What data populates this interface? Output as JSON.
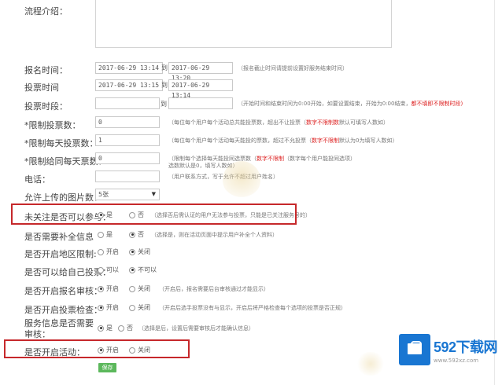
{
  "form": {
    "intro_label": "流程介绍：",
    "signup_time": {
      "label": "报名时间：",
      "start": "2017-06-29 13:14",
      "sep": "到",
      "end": "2017-06-29 13:20",
      "hint": "（报名截止时间请提前设置好服务结束时间）"
    },
    "vote_time": {
      "label": "投票时间",
      "start": "2017-06-29 13:15",
      "sep": "到",
      "end": "2017-06-29 13:14"
    },
    "vote_period": {
      "label": "投票时段：",
      "sep": "到",
      "hint_a": "（开始时间和结束时间为0:00开始，如要设置结束，开始为0:00结束，",
      "hint_red": "都不填即不限制时段)"
    },
    "limit_total": {
      "label": "*限制投票数：",
      "value": "0",
      "hint_a": "（每位每个用户每个活动总共能投票数，超出不让投票（",
      "hint_red": "数字不限制数",
      "hint_b": "默认可填写人数如）"
    },
    "limit_daily": {
      "label": "*限制每天投票数：",
      "value": "1",
      "hint_a": "（每位每个用户每个活动每天能投的票数，超过不允投票（",
      "hint_red": "数字不限制",
      "hint_b": "默认为0为填写人数如）"
    },
    "limit_same": {
      "label": "*限制给同每天票数：",
      "value": "0",
      "hint_a": "（限制每个选择每天能投同选票数（",
      "hint_red": "数字不限制",
      "hint_b": "（数字每个用户能投同选项）",
      "hint_c": "选数默认是0，填写人数如）"
    },
    "phone": {
      "label": "电话：",
      "hint": "（用户联系方式，写于允许不超过用户姓名）"
    },
    "max_images": {
      "label": "允许上传的图片数：",
      "value": "5张"
    },
    "must_follow": {
      "label": "未关注是否可以参与：",
      "opt_yes": "是",
      "opt_no": "否",
      "hint": "（选择否后需认证的用户无法参与投票，只能是已关注服务号的）"
    },
    "require_info": {
      "label": "是否需要补全信息",
      "opt_yes": "是",
      "opt_no": "否",
      "hint": "（选择是，则在活动页面中提示用户补全个人资料）"
    },
    "region_limit": {
      "label": "是否开启地区限制:",
      "opt_on": "开启",
      "opt_off": "关闭"
    },
    "self_vote": {
      "label": "是否可以给自己投票：",
      "opt_on": "可以",
      "opt_off": "不可以"
    },
    "review_signup": {
      "label": "是否开启报名审核：",
      "opt_on": "开启",
      "opt_off": "关闭",
      "hint": "（开启后，报名需要后台审核通过才能显示）"
    },
    "vote_check": {
      "label": "是否开启投票检查：",
      "opt_on": "开启",
      "opt_off": "关闭",
      "hint": "（开启后选手投票没有与显示，开启后将严格检查每个选项的投票是否正规）"
    },
    "service_review": {
      "label": "服务信息是否需要审核：",
      "opt_yes": "是",
      "opt_no": "否",
      "hint": "（选择是后，设置后需要审核后才能确认信息）"
    },
    "open_activity": {
      "label": "是否开启活动：",
      "opt_on": "开启",
      "opt_off": "关闭"
    },
    "save_label": "保存"
  },
  "logo": {
    "title": "592下载网",
    "url": "www.592xz.com"
  },
  "colors": {
    "highlight": "#c6282b",
    "save": "#5cb85c",
    "logo": "#1976d2",
    "hint_red": "#d22222"
  }
}
